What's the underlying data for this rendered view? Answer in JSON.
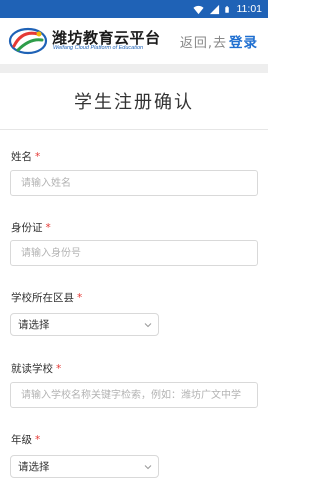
{
  "status_bar": {
    "time": "11:01",
    "icons": [
      "wifi-icon",
      "signal-icon",
      "battery-icon"
    ],
    "background": "#1f62b6"
  },
  "header": {
    "brand_title": "潍坊教育云平台",
    "brand_subtitle": "Weifang Cloud Platform of Education",
    "back_text": "返回,去",
    "login_label": "登录",
    "accent_color": "#1f6fd0"
  },
  "page": {
    "title": "学生注册确认"
  },
  "form": {
    "required_mark": "*",
    "name": {
      "label": "姓名",
      "placeholder": "请输入姓名",
      "value": ""
    },
    "id_card": {
      "label": "身份证",
      "placeholder": "请输入身份号",
      "value": ""
    },
    "district": {
      "label": "学校所在区县",
      "selected": "请选择"
    },
    "school": {
      "label": "就读学校",
      "placeholder": "请输入学校名称关键字检索，例如：潍坊广文中学",
      "value": ""
    },
    "grade": {
      "label": "年级",
      "selected": "请选择"
    }
  }
}
